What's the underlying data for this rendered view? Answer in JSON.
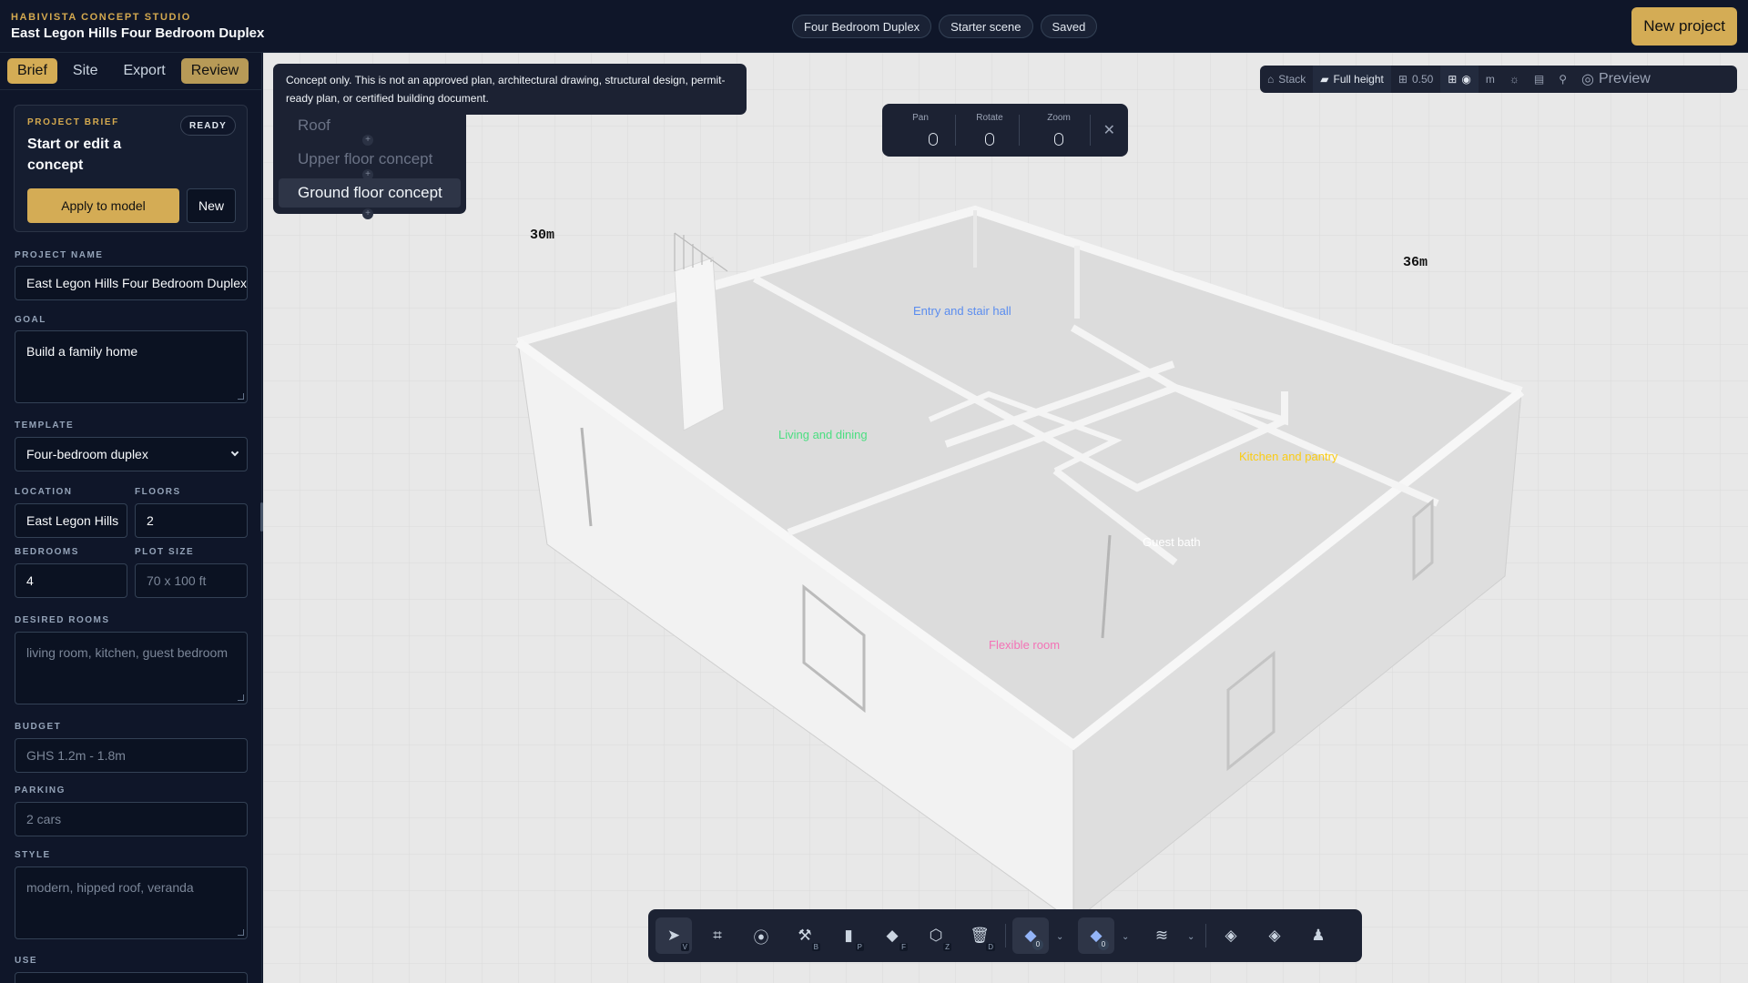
{
  "header": {
    "studio": "HABIVISTA CONCEPT STUDIO",
    "title": "East Legon Hills Four Bedroom Duplex",
    "chips": [
      "Four Bedroom Duplex",
      "Starter scene",
      "Saved"
    ],
    "new_project": "New project"
  },
  "sidebar": {
    "tabs": [
      "Brief",
      "Site",
      "Export",
      "Review"
    ],
    "brief": {
      "label": "PROJECT BRIEF",
      "badge": "READY",
      "heading": "Start or edit a concept",
      "apply": "Apply to model",
      "new": "New"
    },
    "fields": {
      "project_name": {
        "label": "PROJECT NAME",
        "value": "East Legon Hills Four Bedroom Duplex"
      },
      "goal": {
        "label": "GOAL",
        "value": "Build a family home"
      },
      "template": {
        "label": "TEMPLATE",
        "value": "Four-bedroom duplex"
      },
      "location": {
        "label": "LOCATION",
        "value": "East Legon Hills"
      },
      "floors": {
        "label": "FLOORS",
        "value": "2"
      },
      "bedrooms": {
        "label": "BEDROOMS",
        "value": "4"
      },
      "plot_size": {
        "label": "PLOT SIZE",
        "placeholder": "70 x 100 ft"
      },
      "desired_rooms": {
        "label": "DESIRED ROOMS",
        "placeholder": "living room, kitchen, guest bedroom"
      },
      "budget": {
        "label": "BUDGET",
        "placeholder": "GHS 1.2m - 1.8m"
      },
      "parking": {
        "label": "PARKING",
        "placeholder": "2 cars"
      },
      "style": {
        "label": "STYLE",
        "placeholder": "modern, hipped roof, veranda"
      },
      "use": {
        "label": "USE"
      }
    }
  },
  "viewport": {
    "notice": "Concept only. This is not an approved plan, architectural drawing, structural design, permit-ready plan, or certified building document.",
    "floors": [
      "Roof",
      "Upper floor concept",
      "Ground floor concept"
    ],
    "active_floor": "Ground floor concept",
    "camera": {
      "pan": "Pan",
      "rotate": "Rotate",
      "zoom": "Zoom"
    },
    "toolbar": {
      "stack": "Stack",
      "full_height": "Full height",
      "opacity": "0.50",
      "unit": "m",
      "preview": "Preview"
    },
    "dimensions": {
      "width": "30m",
      "depth": "36m"
    },
    "rooms": [
      {
        "name": "Entry and stair hall",
        "color": "#5b8def"
      },
      {
        "name": "Living and dining",
        "color": "#4ade80"
      },
      {
        "name": "Kitchen and pantry",
        "color": "#facc15"
      },
      {
        "name": "Guest bath",
        "color": "#ffffff"
      },
      {
        "name": "Flexible room",
        "color": "#f472b6"
      }
    ],
    "tools": {
      "select_key": "V",
      "box_key": "B",
      "paint_key": "P",
      "floor_key": "F",
      "zone_key": "Z",
      "delete_key": "D",
      "level_count_a": "0",
      "level_count_b": "0"
    }
  },
  "colors": {
    "accent": "#d4ac55",
    "panel": "#1c2233",
    "sidebar": "#0f1629"
  }
}
